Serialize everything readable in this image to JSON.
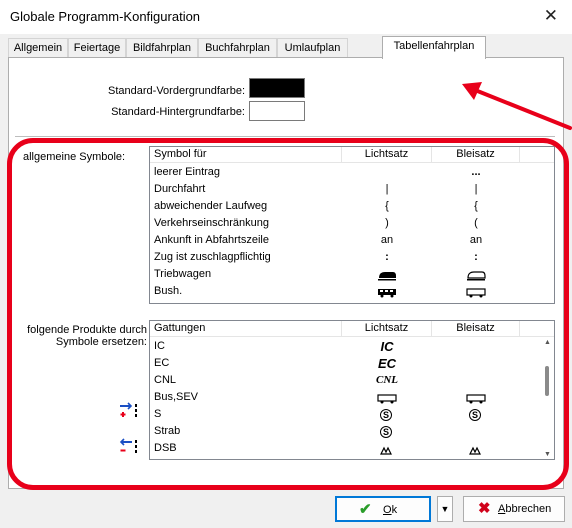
{
  "window": {
    "title": "Globale Programm-Konfiguration",
    "close_glyph": "✕"
  },
  "tabs": [
    {
      "label": "Allgemein",
      "active": false
    },
    {
      "label": "Feiertage",
      "active": false
    },
    {
      "label": "Bildfahrplan",
      "active": false
    },
    {
      "label": "Buchfahrplan",
      "active": false
    },
    {
      "label": "Umlaufplan",
      "active": false
    },
    {
      "label": "Tabellenfahrplan",
      "active": true
    }
  ],
  "colors": {
    "foreground_label": "Standard-Vordergrundfarbe:",
    "foreground_value": "#000000",
    "background_label": "Standard-Hintergrundfarbe:",
    "background_value": "#ffffff"
  },
  "symbols": {
    "label": "allgemeine Symbole:",
    "columns": [
      "Symbol für",
      "Lichtsatz",
      "Bleisatz"
    ],
    "rows": [
      {
        "name": "leerer Eintrag",
        "lichtsatz": "",
        "bleisatz": "..."
      },
      {
        "name": "Durchfahrt",
        "lichtsatz": "|",
        "bleisatz": "|"
      },
      {
        "name": "abweichender Laufweg",
        "lichtsatz": "{",
        "bleisatz": "{"
      },
      {
        "name": "Verkehrseinschränkung",
        "lichtsatz": ")",
        "bleisatz": "("
      },
      {
        "name": "Ankunft in Abfahrtszeile",
        "lichtsatz": "an",
        "bleisatz": "an"
      },
      {
        "name": "Zug ist zuschlagpflichtig",
        "lichtsatz": ":",
        "bleisatz": ":"
      },
      {
        "name": "Triebwagen",
        "lichtsatz": "railcar-icon",
        "bleisatz": "railcar-icon"
      },
      {
        "name": "Bush.",
        "lichtsatz": "bus-icon",
        "bleisatz": "bus-icon"
      }
    ]
  },
  "products": {
    "label": "folgende Produkte durch Symbole ersetzen:",
    "columns": [
      "Gattungen",
      "Lichtsatz",
      "Bleisatz"
    ],
    "rows": [
      {
        "name": "IC",
        "lichtsatz": "IC",
        "bleisatz": ""
      },
      {
        "name": "EC",
        "lichtsatz": "EC",
        "bleisatz": ""
      },
      {
        "name": "CNL",
        "lichtsatz": "CNL",
        "bleisatz": ""
      },
      {
        "name": "Bus,SEV",
        "lichtsatz": "bus-icon",
        "bleisatz": "bus-icon"
      },
      {
        "name": "S",
        "lichtsatz": "S",
        "bleisatz": "S"
      },
      {
        "name": "Strab",
        "lichtsatz": "S",
        "bleisatz": ""
      },
      {
        "name": "DSB",
        "lichtsatz": "dsb-icon",
        "bleisatz": "dsb-icon"
      }
    ],
    "add_button": "add-product-icon",
    "remove_button": "remove-product-icon"
  },
  "buttons": {
    "ok_label": "Ok",
    "ok_mnemonic": "O",
    "cancel_label": "Abbrechen",
    "cancel_mnemonic": "A"
  },
  "annotation": {
    "color": "#e8001a"
  }
}
